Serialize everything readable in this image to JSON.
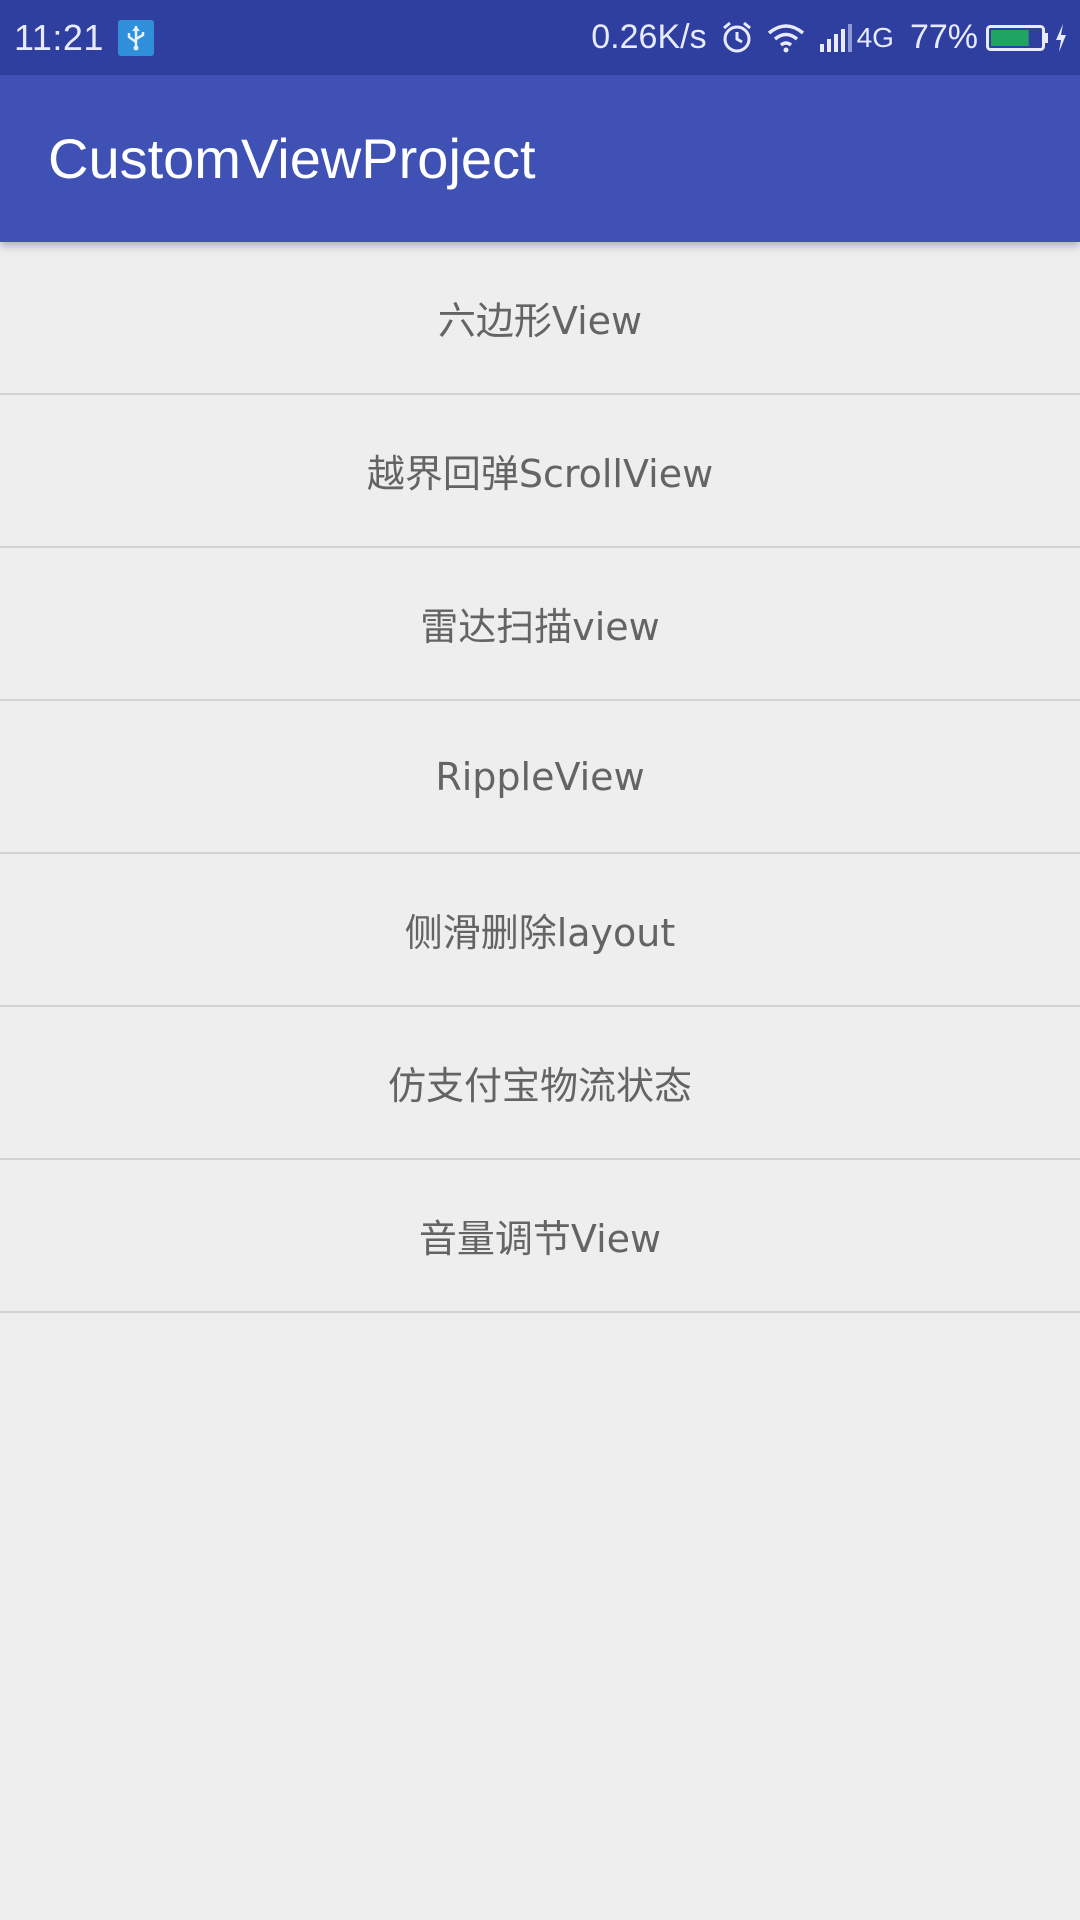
{
  "status_bar": {
    "time": "11:21",
    "net_speed": "0.26K/s",
    "network_type": "4G",
    "battery_percent": "77%",
    "battery_level": 0.77,
    "icons": [
      "usb-icon",
      "alarm-icon",
      "wifi-icon",
      "cell-signal-icon",
      "battery-icon",
      "charging-icon"
    ]
  },
  "app_bar": {
    "title": "CustomViewProject",
    "color": "#3f51b5"
  },
  "list": {
    "items": [
      {
        "label": "六边形View"
      },
      {
        "label": "越界回弹ScrollView"
      },
      {
        "label": "雷达扫描view"
      },
      {
        "label": "RippleView"
      },
      {
        "label": "侧滑删除layout"
      },
      {
        "label": "仿支付宝物流状态"
      },
      {
        "label": "音量调节View"
      }
    ]
  }
}
